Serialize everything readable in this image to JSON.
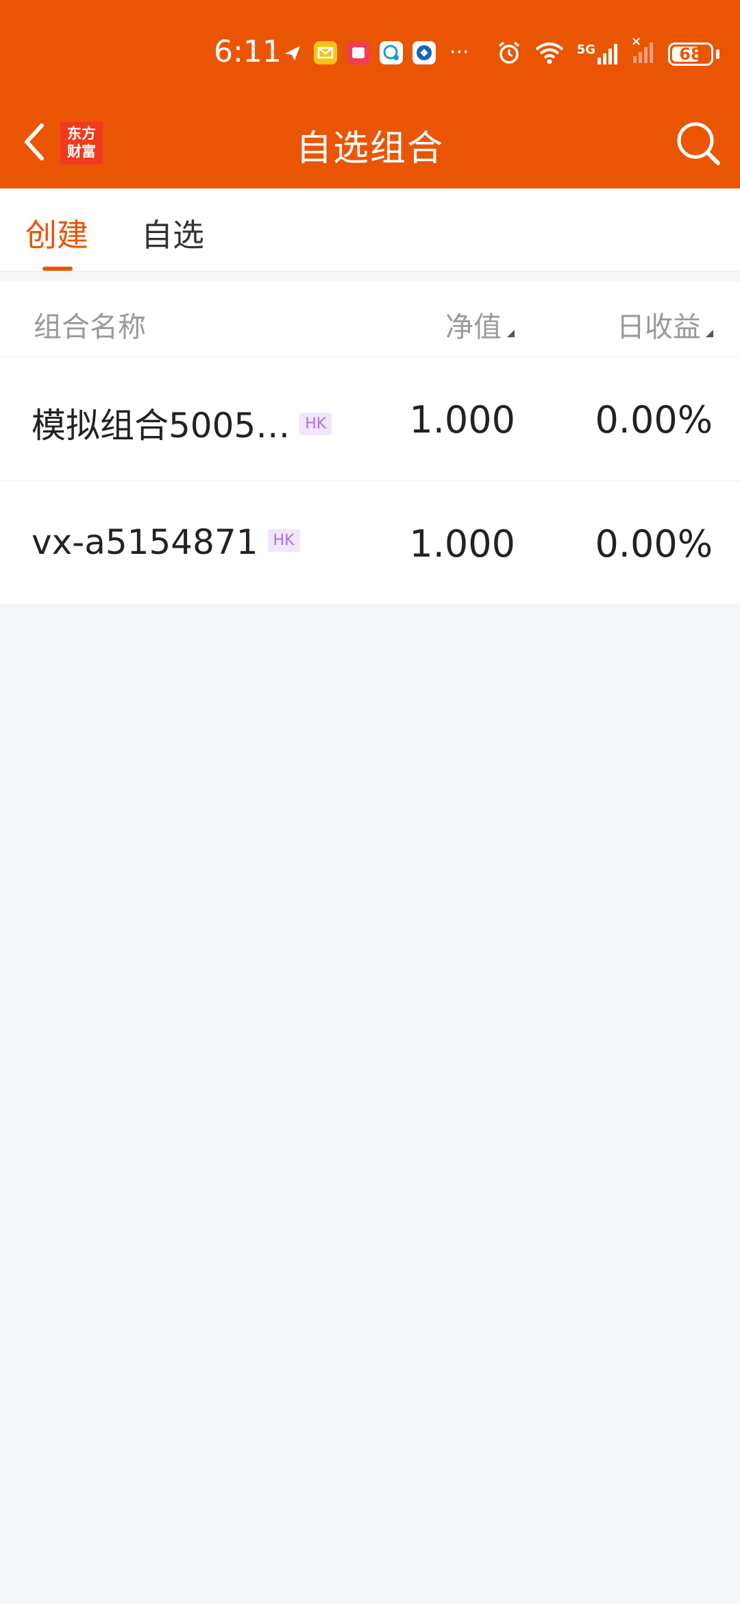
{
  "status_bar": {
    "time": "6:11",
    "battery": "68",
    "network": "5G",
    "notification_icons": [
      "send-icon",
      "mail-icon",
      "red-app-icon",
      "chat-icon",
      "bank-app-icon"
    ],
    "more": "···"
  },
  "nav": {
    "logo_line1": "东方",
    "logo_line2": "财富",
    "title": "自选组合"
  },
  "tabs": [
    {
      "label": "创建",
      "active": true
    },
    {
      "label": "自选",
      "active": false
    }
  ],
  "table": {
    "headers": {
      "name": "组合名称",
      "nav": "净值",
      "daily_return": "日收益"
    },
    "rows": [
      {
        "name": "模拟组合5005…",
        "market": "HK",
        "nav": "1.000",
        "daily_return": "0.00%"
      },
      {
        "name": "vx-a5154871",
        "market": "HK",
        "nav": "1.000",
        "daily_return": "0.00%"
      }
    ]
  },
  "colors": {
    "brand": "#ea5504",
    "logo_bg": "#f03b1d",
    "badge_text": "#a874d9",
    "badge_bg": "#f1e6fb",
    "page_bg": "#f5f6f8"
  }
}
